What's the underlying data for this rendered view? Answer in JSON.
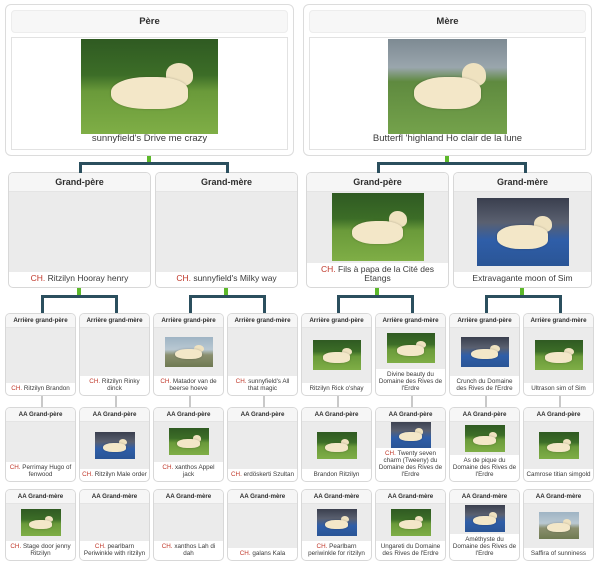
{
  "colors": {
    "connector": "#2b4f5e",
    "connector_green": "#5cb82a",
    "champion_prefix": "#c0392b",
    "card_border": "#d8d8d8",
    "photo_placeholder": "#ebebeb",
    "title_bg": "#f6f6f6"
  },
  "generation1": [
    {
      "title": "Père",
      "name": "sunnyfield's Drive me crazy",
      "champion": "",
      "has_photo": true,
      "photo": "golden-retriever-standing-on-grass"
    },
    {
      "title": "Mère",
      "name": "Butterfl 'highland Ho clair de la lune",
      "champion": "",
      "has_photo": true,
      "photo": "golden-retriever-with-handler-at-show"
    }
  ],
  "generation2": [
    {
      "title": "Grand-père",
      "champion": "CH.",
      "name": "Ritzilyn Hooray henry",
      "has_photo": false,
      "photo": ""
    },
    {
      "title": "Grand-mère",
      "champion": "CH.",
      "name": "sunnyfield's Milky way",
      "has_photo": false,
      "photo": ""
    },
    {
      "title": "Grand-père",
      "champion": "CH.",
      "name": "Fils à papa de la Cité des Etangs",
      "has_photo": true,
      "photo": "golden-retriever-standing-outdoors"
    },
    {
      "title": "Grand-mère",
      "champion": "",
      "name": "Extravagante moon of Sim",
      "has_photo": true,
      "photo": "white-golden-retriever-at-ring"
    }
  ],
  "generation3": [
    {
      "title": "Arrière grand-père",
      "champion": "CH.",
      "name": "Ritzilyn Brandon",
      "has_photo": false,
      "photo": ""
    },
    {
      "title": "Arrière grand-mère",
      "champion": "CH.",
      "name": "Ritzilyn Rinky dinck",
      "has_photo": false,
      "photo": ""
    },
    {
      "title": "Arrière grand-père",
      "champion": "CH.",
      "name": "Matador van de beerse hoeve",
      "has_photo": true,
      "photo": "golden-retriever-with-person"
    },
    {
      "title": "Arrière grand-mère",
      "champion": "CH.",
      "name": "sunnyfield's All that magic",
      "has_photo": false,
      "photo": ""
    },
    {
      "title": "Arrière grand-père",
      "champion": "",
      "name": "Ritzilyn Rick o'shay",
      "has_photo": true,
      "photo": "golden-retriever-on-grass"
    },
    {
      "title": "Arrière grand-mère",
      "champion": "",
      "name": "Divine beauty du Domaine des Rives de l'Erdre",
      "has_photo": true,
      "photo": "golden-retriever-with-handler"
    },
    {
      "title": "Arrière grand-père",
      "champion": "",
      "name": "Crunch du Domaine des Rives de l'Erdre",
      "has_photo": true,
      "photo": "golden-retriever-show-pose"
    },
    {
      "title": "Arrière grand-mère",
      "champion": "",
      "name": "Ultrason sim of Sim",
      "has_photo": true,
      "photo": "golden-retriever-standing"
    }
  ],
  "generation4_sires": [
    {
      "title": "AA Grand-père",
      "champion": "CH.",
      "name": "Perrimay Hugo of fenwood",
      "has_photo": false,
      "photo": ""
    },
    {
      "title": "AA Grand-père",
      "champion": "CH.",
      "name": "Ritzilyn Male order",
      "has_photo": true,
      "photo": "white-golden-retriever"
    },
    {
      "title": "AA Grand-père",
      "champion": "CH.",
      "name": "xanthos Appel jack",
      "has_photo": true,
      "photo": "golden-retriever-with-handler"
    },
    {
      "title": "AA Grand-père",
      "champion": "CH.",
      "name": "erdöskerti Szultan",
      "has_photo": false,
      "photo": ""
    },
    {
      "title": "AA Grand-père",
      "champion": "",
      "name": "Brandon Ritzilyn",
      "has_photo": true,
      "photo": "golden-retriever-on-grass"
    },
    {
      "title": "AA Grand-père",
      "champion": "CH.",
      "name": "Twenty seven charm (Tweeny) du Domaine des Rives de l'Erdre",
      "has_photo": true,
      "photo": "white-retriever-show"
    },
    {
      "title": "AA Grand-père",
      "champion": "",
      "name": "As de pique du Domaine des Rives de l'Erdre",
      "has_photo": true,
      "photo": "retriever-with-handler"
    },
    {
      "title": "AA Grand-père",
      "champion": "",
      "name": "Camrose titian simgold",
      "has_photo": true,
      "photo": "retriever-on-grass"
    }
  ],
  "generation4_dams": [
    {
      "title": "AA Grand-mère",
      "champion": "CH.",
      "name": "Stage door jenny Ritzilyn",
      "has_photo": true,
      "photo": "golden-retriever-dark-background"
    },
    {
      "title": "AA Grand-mère",
      "champion": "CH.",
      "name": "pearlbarn Periwinkle with ritzilyn",
      "has_photo": false,
      "photo": ""
    },
    {
      "title": "AA Grand-mère",
      "champion": "CH.",
      "name": "xanthos Lah di dah",
      "has_photo": false,
      "photo": ""
    },
    {
      "title": "AA Grand-mère",
      "champion": "CH.",
      "name": "galans Kala",
      "has_photo": false,
      "photo": ""
    },
    {
      "title": "AA Grand-mère",
      "champion": "CH.",
      "name": "Pearlbarn periwinkle for ritzilyn",
      "has_photo": true,
      "photo": "retriever-indoor-show"
    },
    {
      "title": "AA Grand-mère",
      "champion": "",
      "name": "Ungareti du Domaine des Rives de l'Erdre",
      "has_photo": true,
      "photo": "retriever-with-handler"
    },
    {
      "title": "AA Grand-mère",
      "champion": "",
      "name": "Améthyste du Domaine des Rives de l'Erdre",
      "has_photo": true,
      "photo": "white-retriever-show"
    },
    {
      "title": "AA Grand-mère",
      "champion": "",
      "name": "Saffira of sunniness",
      "has_photo": true,
      "photo": "retriever-on-rocks"
    }
  ]
}
